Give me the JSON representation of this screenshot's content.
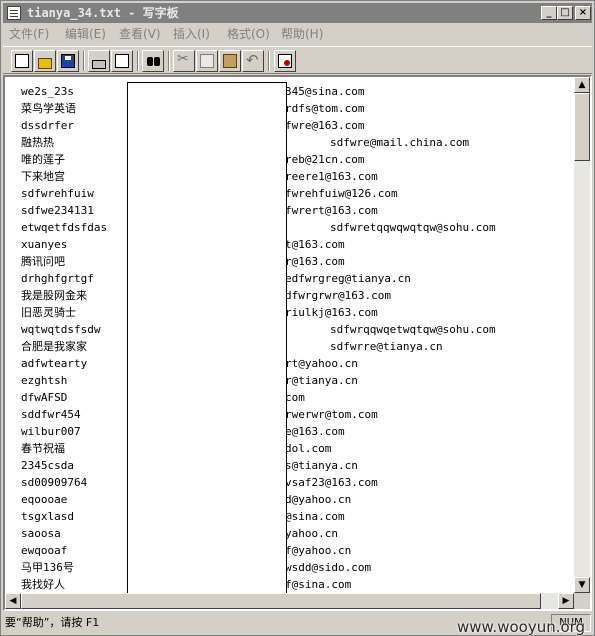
{
  "window": {
    "title": "tianya_34.txt - 写字板",
    "controls": {
      "minimize": "_",
      "maximize": "□",
      "close": "×"
    }
  },
  "menu": [
    {
      "label": "文件(F)"
    },
    {
      "label": "编辑(E)"
    },
    {
      "label": "查看(V)"
    },
    {
      "label": "插入(I)"
    },
    {
      "label": "格式(O)"
    },
    {
      "label": "帮助(H)"
    }
  ],
  "toolbar": [
    {
      "name": "new-document-button",
      "icon": "new-document-icon"
    },
    {
      "name": "open-button",
      "icon": "open-folder-icon"
    },
    {
      "name": "save-button",
      "icon": "save-icon"
    },
    {
      "name": "print-button",
      "icon": "printer-icon"
    },
    {
      "name": "print-preview-button",
      "icon": "print-preview-icon"
    },
    {
      "name": "find-button",
      "icon": "binoculars-icon"
    },
    {
      "name": "cut-button",
      "icon": "scissors-icon"
    },
    {
      "name": "copy-button",
      "icon": "copy-icon"
    },
    {
      "name": "paste-button",
      "icon": "paste-icon"
    },
    {
      "name": "undo-button",
      "icon": "undo-icon"
    },
    {
      "name": "insert-datetime-button",
      "icon": "datetime-icon"
    }
  ],
  "document": {
    "lines": [
      {
        "user": "we2s_23s",
        "email": "345@sina.com",
        "indent": 0
      },
      {
        "user": "菜鸟学英语",
        "email": "rdfs@tom.com",
        "indent": 0
      },
      {
        "user": "dssdrfer",
        "email": "fwre@163.com",
        "indent": 0
      },
      {
        "user": "融热热",
        "email": "sdfwre@mail.china.com",
        "indent": 1
      },
      {
        "user": "唯的莲子",
        "email": "reb@21cn.com",
        "indent": 0
      },
      {
        "user": "下来地宫",
        "email": "reere1@163.com",
        "indent": 0
      },
      {
        "user": "sdfwrehfuiw",
        "email": "fwrehfuiw@126.com",
        "indent": 0
      },
      {
        "user": "sdfwe234131",
        "email": "fwrert@163.com",
        "indent": 0
      },
      {
        "user": "etwqetfdsfdas",
        "email": "sdfwretqqwqwqtqw@sohu.com",
        "indent": 1
      },
      {
        "user": "xuanyes",
        "email": "t@163.com",
        "indent": 0
      },
      {
        "user": "腾讯问吧",
        "email": "r@163.com",
        "indent": 0
      },
      {
        "user": "drhghfgrtgf",
        "email": "edfwrgreg@tianya.cn",
        "indent": 0
      },
      {
        "user": "我是股网金来",
        "email": "dfwrgrwr@163.com",
        "indent": 0
      },
      {
        "user": "旧恶灵骑士",
        "email": "riulkj@163.com",
        "indent": 0
      },
      {
        "user": "wqtwqtdsfsdw",
        "email": "sdfwrqqwqetwqtqw@sohu.com",
        "indent": 1
      },
      {
        "user": "合肥是我家家",
        "email": "sdfwrre@tianya.cn",
        "indent": 1
      },
      {
        "user": "adfwtearty",
        "email": "rt@yahoo.cn",
        "indent": 0
      },
      {
        "user": "ezghtsh",
        "email": "r@tianya.cn",
        "indent": 0
      },
      {
        "user": "dfwAFSD",
        "email": "com",
        "indent": 0
      },
      {
        "user": "sddfwr454",
        "email": "rwerwr@tom.com",
        "indent": 0
      },
      {
        "user": "wilbur007",
        "email": "e@163.com",
        "indent": 0
      },
      {
        "user": "春节祝福",
        "email": "dol.com",
        "indent": 0
      },
      {
        "user": "2345csda",
        "email": "s@tianya.cn",
        "indent": 0
      },
      {
        "user": "sd00909764",
        "email": "vsaf23@163.com",
        "indent": 0
      },
      {
        "user": "eqoooae",
        "email": "d@yahoo.cn",
        "indent": 0
      },
      {
        "user": "tsgxlasd",
        "email": "@sina.com",
        "indent": 0
      },
      {
        "user": "saoosa",
        "email": "yahoo.cn",
        "indent": 0
      },
      {
        "user": "ewqooaf",
        "email": "f@yahoo.cn",
        "indent": 0
      },
      {
        "user": "马甲136号",
        "email": "wsdd@sido.com",
        "indent": 0
      },
      {
        "user": "我找好人",
        "email": "f@sina.com",
        "indent": 0
      },
      {
        "user": "                ",
        "email": "",
        "indent": 0
      }
    ]
  },
  "scrollbars": {
    "up": "▲",
    "down": "▼",
    "left": "◀",
    "right": "▶"
  },
  "status": {
    "help_text": "要“帮助”，请按 F1",
    "mode": "NUM"
  },
  "watermark": "www.wooyun.org",
  "colors": {
    "titlebar_inactive": "#808080",
    "face": "#d4d0c8",
    "paper": "#ffffff"
  }
}
